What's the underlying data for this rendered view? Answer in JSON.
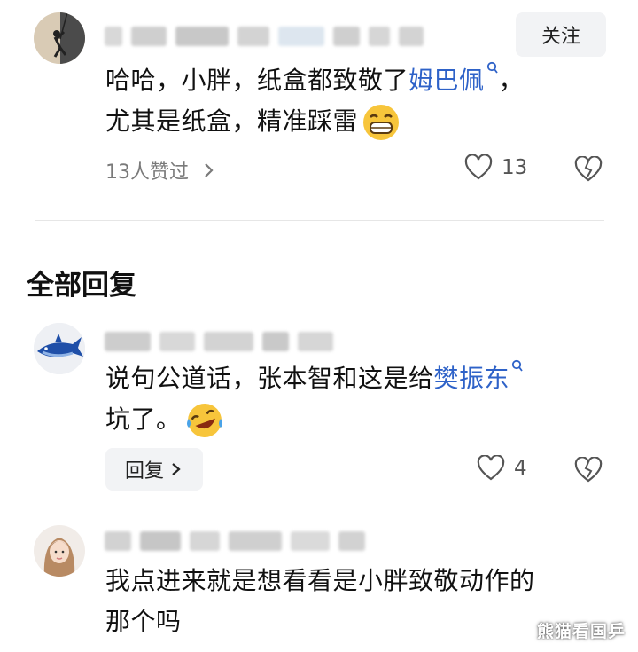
{
  "comment1": {
    "follow_label": "关注",
    "line1_text": "哈哈，小胖，纸盒都致敬了",
    "line1_link": "姆巴佩",
    "line1_after": "，",
    "line2_text": "尤其是纸盒，精准踩雷",
    "liked_by": "13人赞过",
    "like_count": "13"
  },
  "section_title": "全部回复",
  "reply1": {
    "line1_text": "说句公道话，张本智和这是给",
    "line1_link": "樊振东",
    "line2_text": "坑了。",
    "reply_button": "回复",
    "like_count": "4"
  },
  "reply2": {
    "line1_text": "我点进来就是想看看是小胖致敬动作的",
    "line2_text": "那个吗"
  },
  "watermark": "熊猫看国乒",
  "colors": {
    "link": "#2e62c8",
    "button_bg": "#f2f3f5",
    "muted": "#7a7a7a"
  },
  "icons": [
    "avatar-climber",
    "search-icon",
    "grin-emoji-icon",
    "heart-icon",
    "broken-heart-icon",
    "chevron-right-icon",
    "avatar-shark",
    "laugh-cry-emoji-icon",
    "avatar-girl"
  ]
}
